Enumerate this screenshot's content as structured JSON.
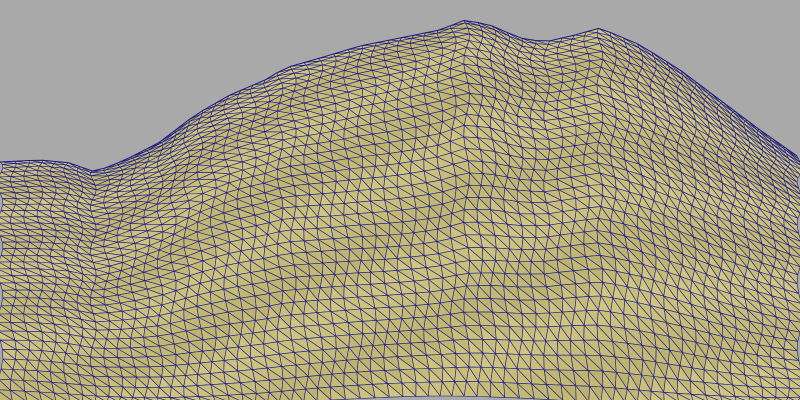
{
  "viewport": {
    "background_color": "#a9a9a9",
    "terrain_fill_light": "#d6cb84",
    "terrain_fill_dark": "#a89d58",
    "wireframe_color": "#1a1a8c"
  }
}
